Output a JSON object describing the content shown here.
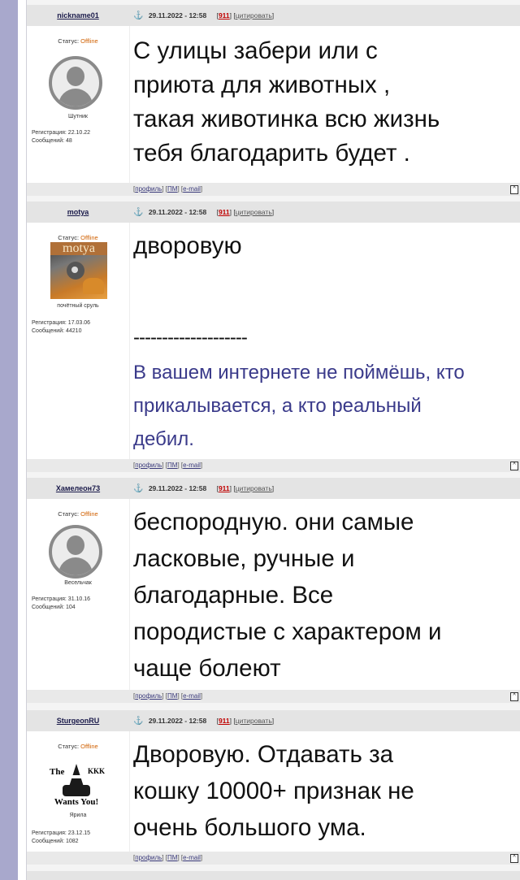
{
  "posts": [
    {
      "nick": "nickname01",
      "date": "29.11.2022 - 12:58",
      "post_num": "911",
      "quote_label": "цитировать",
      "status_label": "Статус:",
      "status_value": "Offline",
      "avatar": "default-avatar",
      "user_title": "Шутник",
      "reg_label": "Регистрация: 22.10.22",
      "msgs_label": "Сообщений: 48",
      "message_lines": [
        "С улицы забери или с",
        "приюта для животных ,",
        "такая животинка всю жизнь",
        "тебя благодарить будет ."
      ]
    },
    {
      "nick": "motya",
      "date": "29.11.2022 - 12:58",
      "post_num": "911",
      "quote_label": "цитировать",
      "status_label": "Статус:",
      "status_value": "Offline",
      "avatar": "motya-avatar",
      "avatar_text": "motya",
      "user_title": "почётный сруль",
      "reg_label": "Регистрация: 17.03.06",
      "msgs_label": "Сообщений: 44210",
      "message_lines": [
        "дворовую"
      ],
      "signature_separator": "--------------------",
      "signature_lines": [
        "В вашем интернете не поймёшь, кто",
        "прикалывается, а кто реальный",
        "дебил."
      ]
    },
    {
      "nick": "Хамелеон73",
      "date": "29.11.2022 - 12:58",
      "post_num": "911",
      "quote_label": "цитировать",
      "status_label": "Статус:",
      "status_value": "Offline",
      "avatar": "default-avatar",
      "user_title": "Весельчак",
      "reg_label": "Регистрация: 31.10.16",
      "msgs_label": "Сообщений: 104",
      "message_lines": [
        "беспородную. они самые",
        "ласковые, ручные и",
        "благодарные. Все",
        "породистые с характером и",
        "чаще болеют"
      ]
    },
    {
      "nick": "SturgeonRU",
      "date": "29.11.2022 - 12:58",
      "post_num": "911",
      "quote_label": "цитировать",
      "status_label": "Статус:",
      "status_value": "Offline",
      "avatar": "kkk-avatar",
      "avatar_text_the": "The",
      "avatar_text_kkk": "KKK",
      "avatar_text_wants": "Wants You!",
      "user_title": "Ярила",
      "reg_label": "Регистрация: 23.12.15",
      "msgs_label": "Сообщений: 1082",
      "message_lines": [
        "Дворовую. Отдавать за",
        "кошку 10000+ признак не",
        "очень большого ума."
      ]
    }
  ],
  "footer_links": {
    "profile": "профиль",
    "pm": "ПМ",
    "email": "e-mail"
  },
  "up_button": "^",
  "colors": {
    "left_bar": "#a8a8cc",
    "header_bg": "#e4e4e4",
    "offline": "#d06000",
    "post_num": "#c00000",
    "signature": "#3a3a8a"
  }
}
